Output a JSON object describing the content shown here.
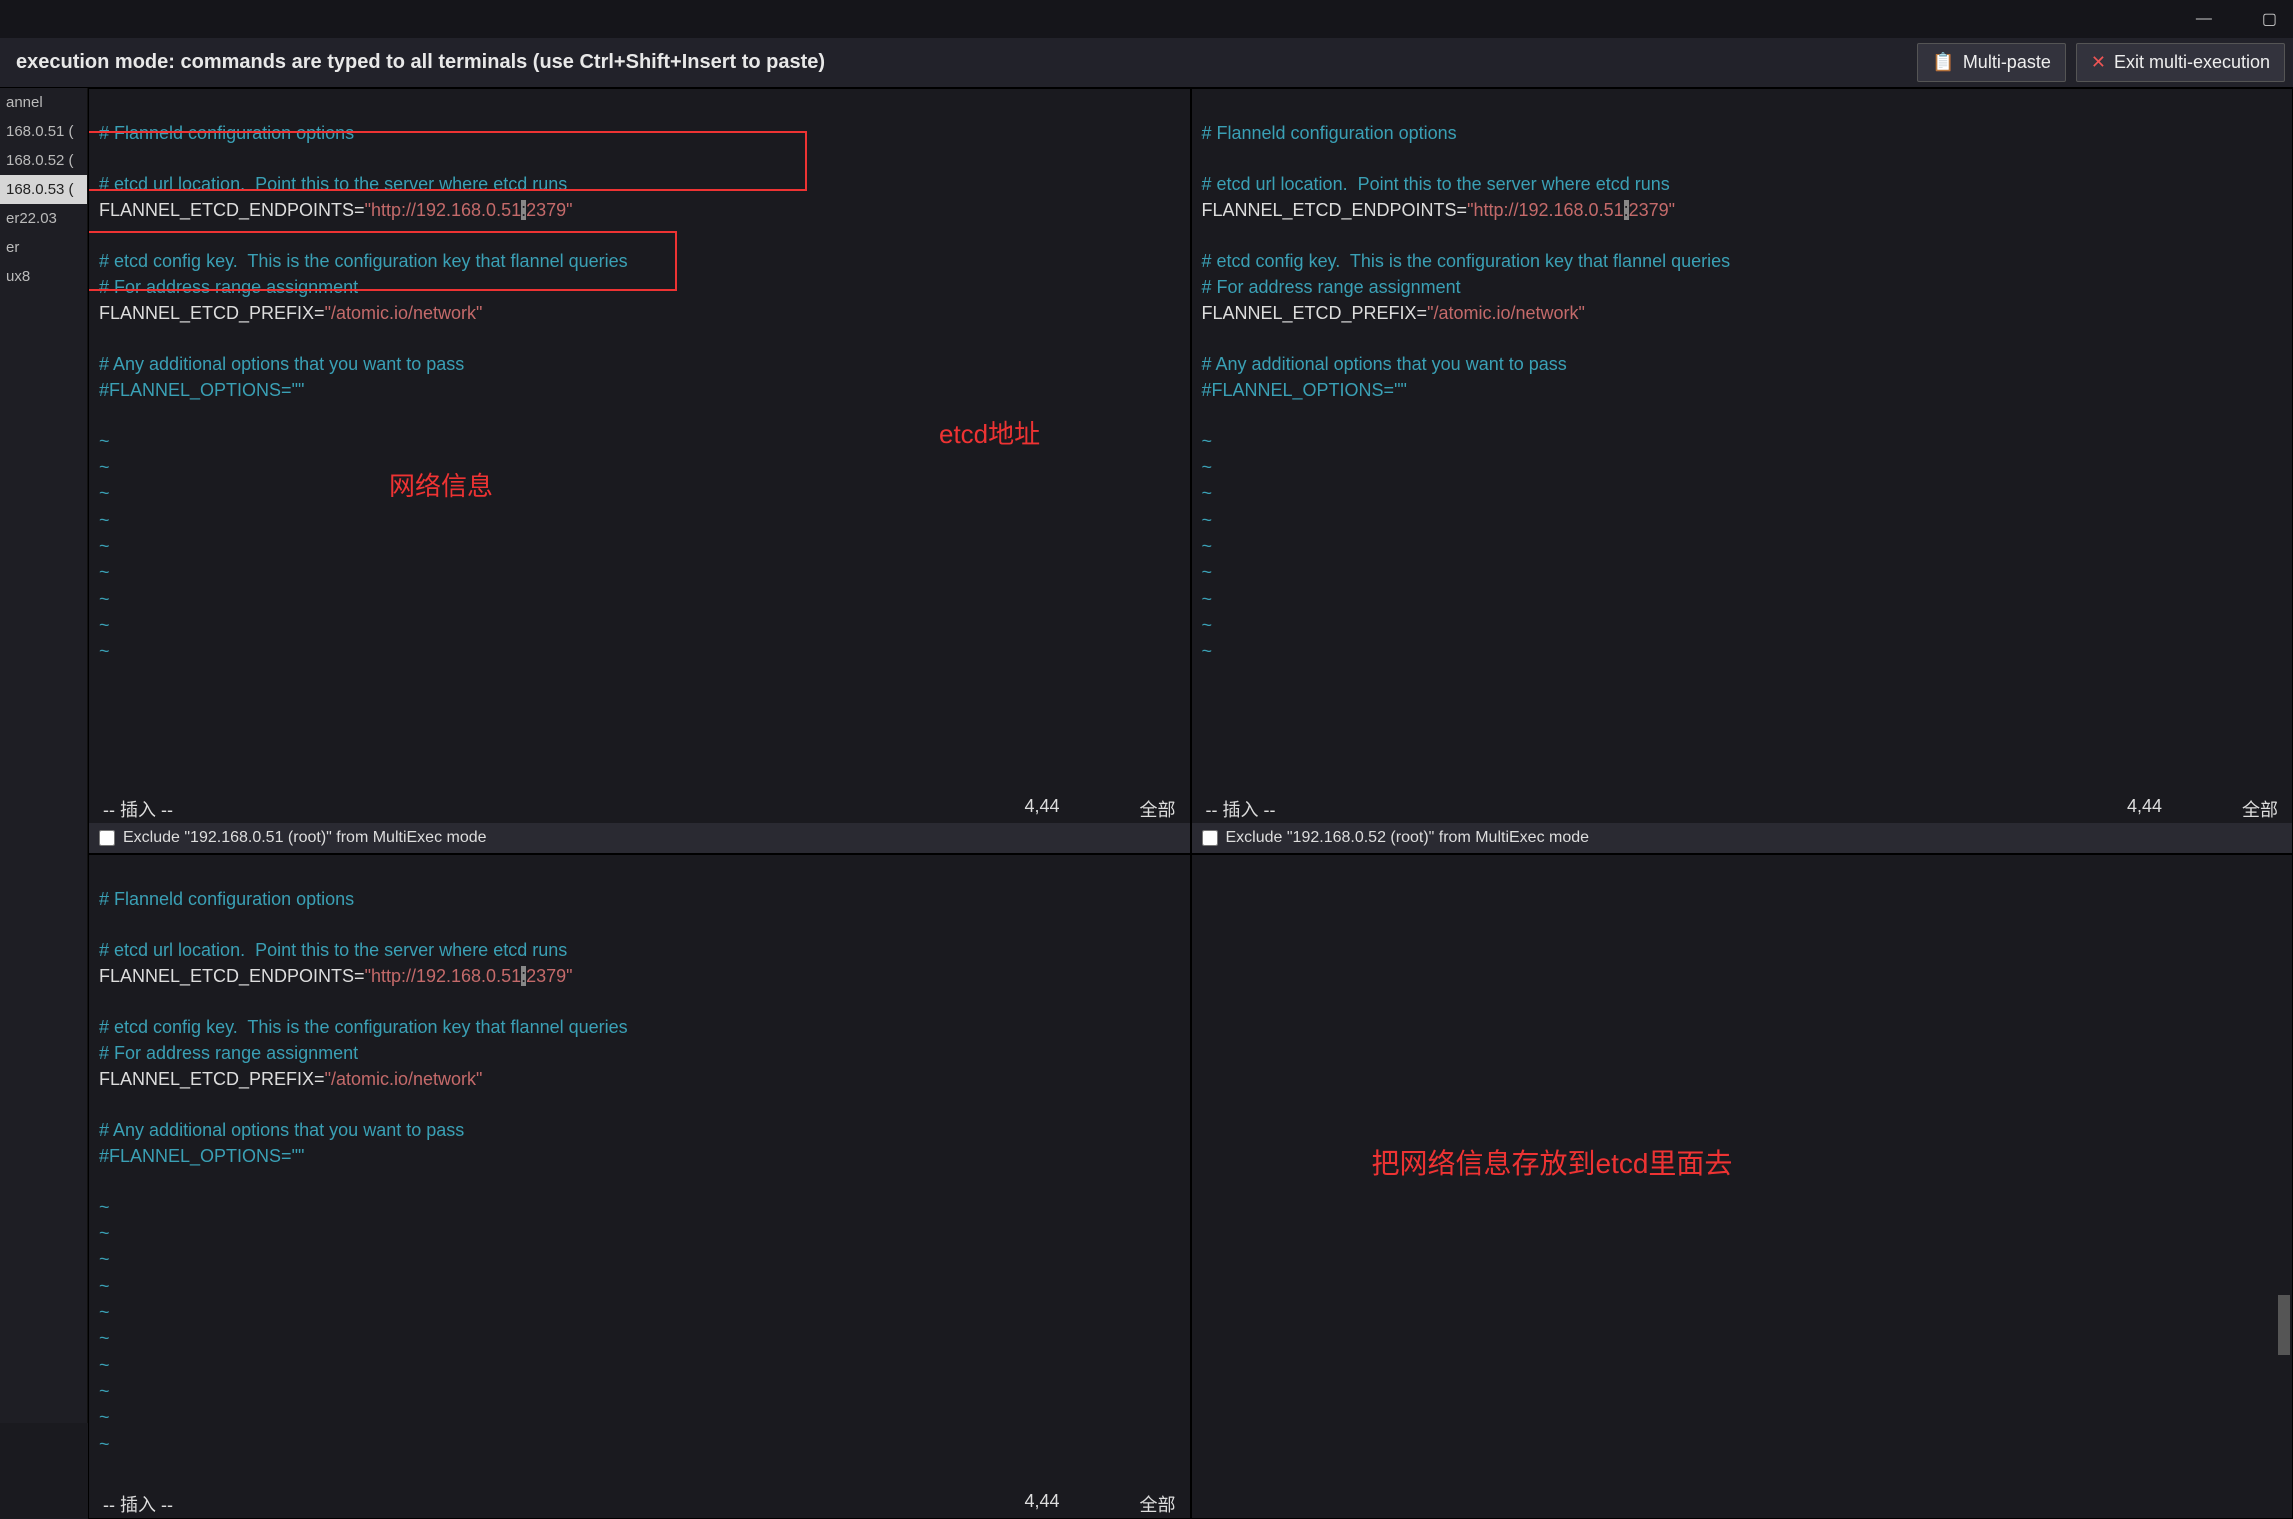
{
  "titlebar": {
    "min": "—",
    "max": "▢"
  },
  "toolbar": {
    "msg": "execution mode: commands are typed to all terminals (use Ctrl+Shift+Insert to paste)",
    "multi_paste": "Multi-paste",
    "exit": "Exit multi-execution"
  },
  "sidebar": {
    "items": [
      "annel",
      "168.0.51 (",
      "168.0.52 (",
      "168.0.53 (",
      "er22.03",
      "er",
      "ux8"
    ]
  },
  "config": {
    "l1": "# Flanneld configuration options",
    "l2": "# etcd url location.  Point this to the server where etcd runs",
    "l3_key": "FLANNEL_ETCD_ENDPOINTS=",
    "l3_val": "\"http://192.168.0.51:2379\"",
    "l3_val_pre": "\"http://192.168.0.51",
    "l3_cursor": ":",
    "l3_val_post": "2379\"",
    "l4": "# etcd config key.  This is the configuration key that flannel queries",
    "l5": "# For address range assignment",
    "l6_key": "FLANNEL_ETCD_PREFIX=",
    "l6_val": "\"/atomic.io/network\"",
    "l7": "# Any additional options that you want to pass",
    "l8": "#FLANNEL_OPTIONS=\"\""
  },
  "status": {
    "mode": "-- 插入 --",
    "pos": "4,44",
    "scope": "全部"
  },
  "exclude": {
    "p1": "Exclude \"192.168.0.51 (root)\" from MultiExec mode",
    "p2": "Exclude \"192.168.0.52 (root)\" from MultiExec mode"
  },
  "annot": {
    "etcd": "etcd地址",
    "net": "网络信息",
    "store": "把网络信息存放到etcd里面去"
  }
}
